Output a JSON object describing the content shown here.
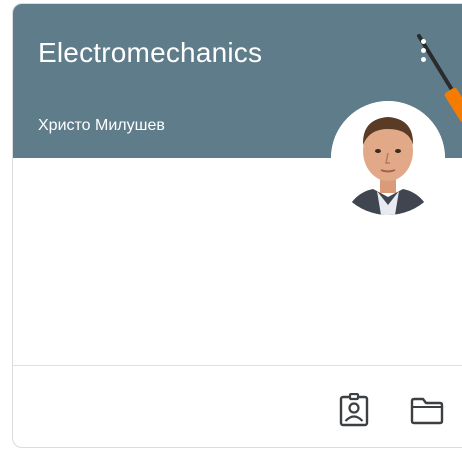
{
  "card": {
    "title": "Electromechanics",
    "teacher": "Христо Милушев",
    "header_color": "#5f7c8a",
    "accent_color": "#f57c00"
  },
  "icons": {
    "more": "more-vert-icon",
    "work": "assignment-ind-icon",
    "folder": "folder-icon"
  }
}
